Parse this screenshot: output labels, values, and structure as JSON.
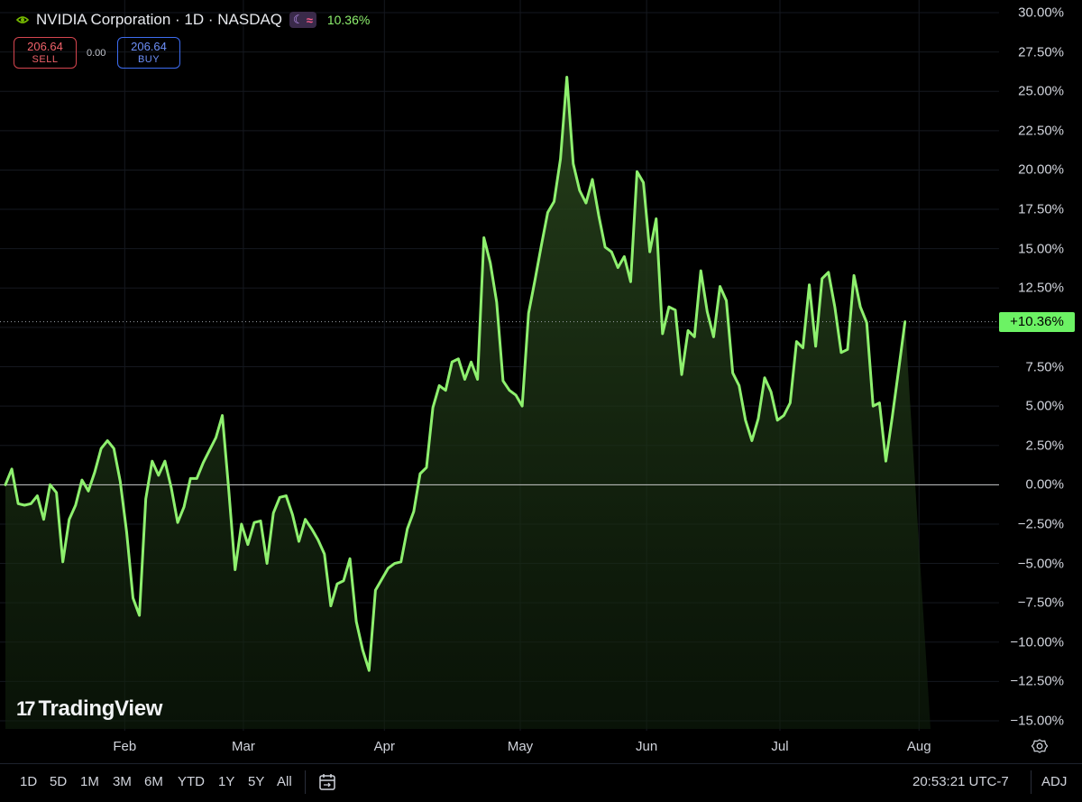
{
  "header": {
    "title": "NVIDIA Corporation · 1D · NASDAQ",
    "moon_icon": "☾",
    "wave_icon": "≈",
    "change_pct": "10.36%"
  },
  "trade": {
    "sell_price": "206.64",
    "sell_label": "SELL",
    "spread": "0.00",
    "buy_price": "206.64",
    "buy_label": "BUY"
  },
  "watermark": {
    "mark": "17",
    "text": "TradingView"
  },
  "last_value_label": "+10.36%",
  "range_buttons": [
    "1D",
    "5D",
    "1M",
    "3M",
    "6M",
    "YTD",
    "1Y",
    "5Y",
    "All"
  ],
  "clock": "20:53:21 UTC-7",
  "adj": "ADJ",
  "colors": {
    "line": "#8ef06e",
    "badge": "#6cf264",
    "background": "#000000"
  },
  "chart_data": {
    "type": "area",
    "title": "",
    "xlabel": "",
    "ylabel": "",
    "ylim": [
      -15,
      30
    ],
    "y_ticks": [
      "30.00%",
      "27.50%",
      "25.00%",
      "22.50%",
      "20.00%",
      "17.50%",
      "15.00%",
      "12.50%",
      "10.00%",
      "7.50%",
      "5.00%",
      "2.50%",
      "0.00%",
      "−12.50%",
      "−15.00%",
      "−2.50%",
      "−5.00%",
      "−7.50%",
      "−10.00%"
    ],
    "y_tick_values": [
      30,
      27.5,
      25,
      22.5,
      20,
      17.5,
      15,
      12.5,
      10,
      7.5,
      5,
      2.5,
      0,
      -12.5,
      -15,
      -2.5,
      -5,
      -7.5,
      -10
    ],
    "x_labels": [
      "Feb",
      "Mar",
      "Apr",
      "May",
      "Jun",
      "Jul",
      "Aug"
    ],
    "x_label_index": [
      18.7,
      37.3,
      59.4,
      80.7,
      100.5,
      121.4,
      143.2
    ],
    "x_count": 146,
    "series": [
      {
        "name": "NVIDIA Corporation",
        "values": [
          0.0,
          1.0,
          -1.2,
          -1.3,
          -1.2,
          -0.7,
          -2.2,
          0.0,
          -0.5,
          -4.9,
          -2.2,
          -1.3,
          0.3,
          -0.4,
          0.8,
          2.3,
          2.8,
          2.3,
          0.2,
          -3.0,
          -7.2,
          -8.3,
          -0.9,
          1.5,
          0.6,
          1.5,
          -0.2,
          -2.4,
          -1.4,
          0.4,
          0.4,
          1.4,
          2.2,
          3.0,
          4.4,
          -0.3,
          -5.4,
          -2.5,
          -3.8,
          -2.4,
          -2.3,
          -5.0,
          -1.8,
          -0.8,
          -0.7,
          -1.9,
          -3.6,
          -2.2,
          -2.8,
          -3.5,
          -4.4,
          -7.7,
          -6.3,
          -6.1,
          -4.7,
          -8.7,
          -10.5,
          -11.8,
          -6.7,
          -6.0,
          -5.3,
          -5.0,
          -4.9,
          -2.8,
          -1.7,
          0.7,
          1.1,
          4.9,
          6.3,
          6.0,
          7.8,
          8.0,
          6.7,
          7.8,
          6.7,
          15.7,
          14.1,
          11.6,
          6.6,
          6.0,
          5.7,
          5.0,
          10.9,
          13.0,
          15.2,
          17.3,
          18.0,
          20.7,
          25.9,
          20.4,
          18.7,
          17.9,
          19.4,
          17.1,
          15.1,
          14.8,
          13.8,
          14.5,
          12.9,
          19.9,
          19.2,
          14.8,
          16.9,
          9.6,
          11.3,
          11.1,
          7.0,
          9.8,
          9.4,
          13.6,
          11.0,
          9.4,
          12.6,
          11.7,
          7.1,
          6.3,
          4.1,
          2.8,
          4.2,
          6.8,
          5.9,
          4.1,
          4.4,
          5.2,
          9.1,
          8.7,
          12.7,
          8.8,
          13.1,
          13.5,
          11.3,
          8.4,
          8.6,
          13.3,
          11.3,
          10.3,
          5.0,
          5.2,
          1.5,
          4.3,
          7.3,
          10.36
        ]
      }
    ],
    "reference_line": 0,
    "last_value": 10.36,
    "grid": true,
    "legend": "none"
  }
}
